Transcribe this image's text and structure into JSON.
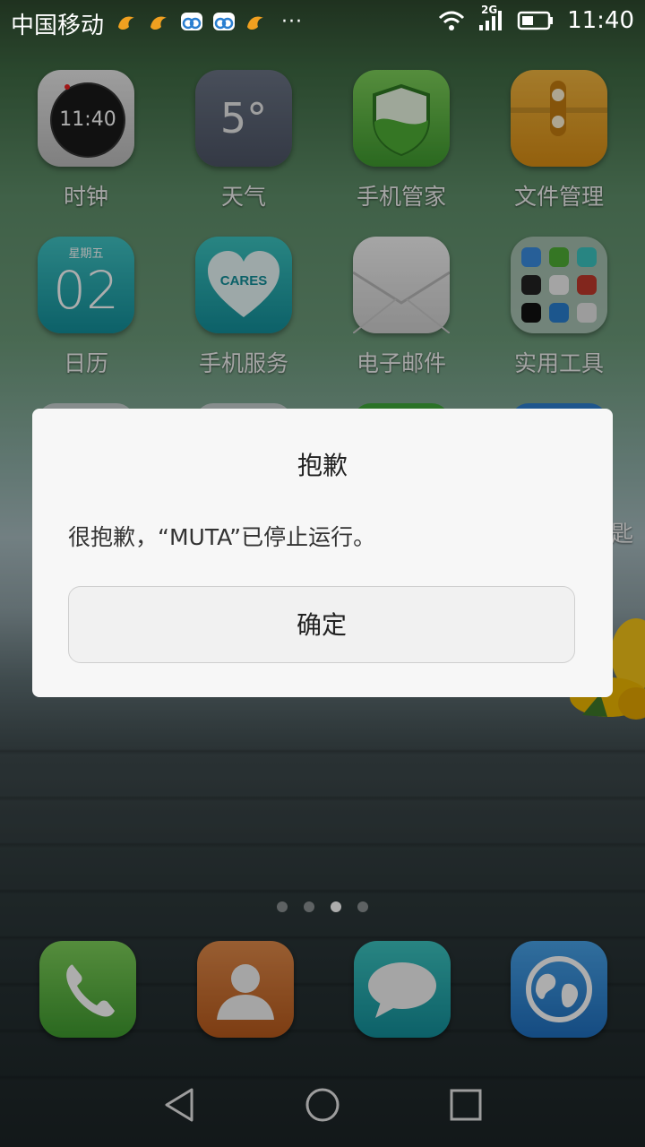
{
  "status_bar": {
    "carrier": "中国移动",
    "network": "2G",
    "time": "11:40",
    "more": "···"
  },
  "home": {
    "apps": [
      {
        "label": "时钟",
        "clock_text": "11:40"
      },
      {
        "label": "天气",
        "temp": "5°"
      },
      {
        "label": "手机管家"
      },
      {
        "label": "文件管理"
      },
      {
        "label": "日历",
        "weekday": "星期五",
        "day": "02"
      },
      {
        "label": "手机服务",
        "badge": "CARES"
      },
      {
        "label": "电子邮件"
      },
      {
        "label": "实用工具"
      }
    ],
    "peek_label": "匙"
  },
  "dialog": {
    "title": "抱歉",
    "message": "很抱歉，“MUTA”已停止运行。",
    "confirm": "确定"
  },
  "page_indicator": {
    "count": 4,
    "active_index": 2
  },
  "colors": {
    "dialog_bg": "#f7f7f7",
    "button_border": "#cfcfcf"
  }
}
